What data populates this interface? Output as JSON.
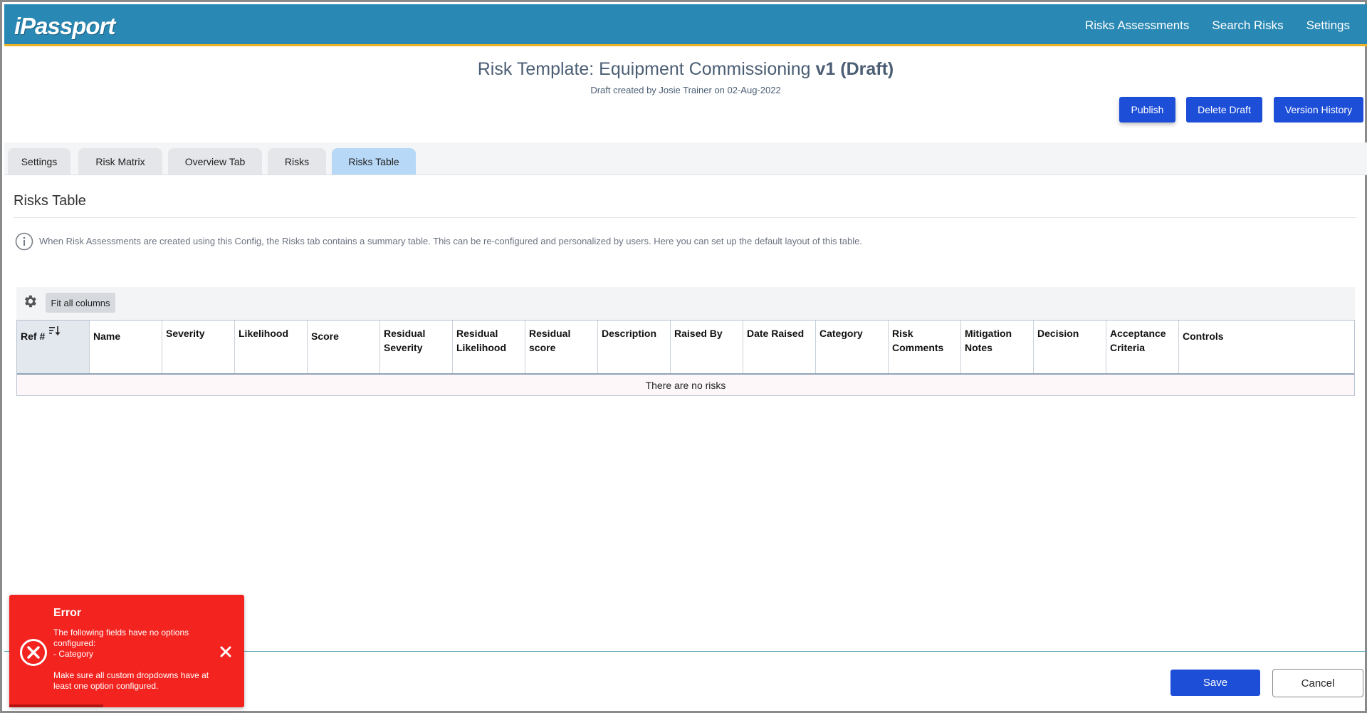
{
  "app": {
    "logo": "iPassport"
  },
  "nav": {
    "items": [
      "Risks Assessments",
      "Search Risks",
      "Settings"
    ]
  },
  "page": {
    "title_prefix": "Risk Template: Equipment Commissioning",
    "title_version": "v1 (Draft)",
    "subtitle": "Draft created by Josie Trainer on 02-Aug-2022"
  },
  "actions": {
    "publish": "Publish",
    "delete_draft": "Delete Draft",
    "version_history": "Version History"
  },
  "tabs": [
    {
      "label": "Settings",
      "active": false
    },
    {
      "label": "Risk Matrix",
      "active": false
    },
    {
      "label": "Overview Tab",
      "active": false
    },
    {
      "label": "Risks",
      "active": false
    },
    {
      "label": "Risks Table",
      "active": true
    }
  ],
  "section": {
    "title": "Risks Table",
    "info": "When Risk Assessments are created using this Config, the Risks tab contains a summary table. This can be re-configured and personalized by users. Here you can set up the default layout of this table."
  },
  "grid": {
    "fit_label": "Fit all columns",
    "columns": [
      "Ref #",
      "Name",
      "Severity",
      "Likelihood",
      "Score",
      "Residual Severity",
      "Residual Likelihood",
      "Residual score",
      "Description",
      "Raised By",
      "Date Raised",
      "Category",
      "Risk Comments",
      "Mitigation Notes",
      "Decision",
      "Acceptance Criteria",
      "Controls"
    ],
    "empty_message": "There are no risks"
  },
  "footer": {
    "save": "Save",
    "cancel": "Cancel"
  },
  "toast": {
    "title": "Error",
    "message": "The following fields have no options configured:\n   - Category\n\nMake sure all custom dropdowns have at least one option configured."
  },
  "colors": {
    "header": "#2a89b4",
    "accent_border": "#f0b323",
    "primary_button": "#1d4ed8",
    "active_tab": "#b7d8f7",
    "error": "#f3231f"
  }
}
